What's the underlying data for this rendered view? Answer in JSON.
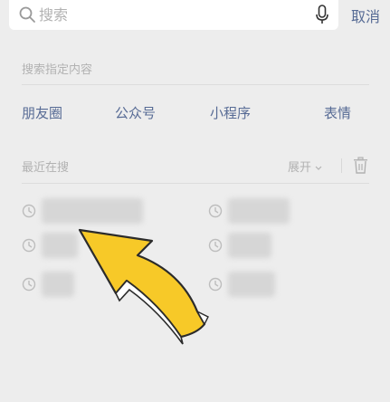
{
  "search": {
    "placeholder": "搜索",
    "cancel_label": "取消"
  },
  "specified": {
    "title": "搜索指定内容",
    "categories": [
      "朋友圈",
      "公众号",
      "小程序",
      "表情"
    ]
  },
  "recent": {
    "title": "最近在搜",
    "expand_label": "展开"
  },
  "icons": {
    "search": "search-icon",
    "mic": "microphone-icon",
    "chevron": "chevron-down-icon",
    "trash": "trash-icon",
    "clock": "clock-icon"
  },
  "colors": {
    "link": "#576B95",
    "muted": "#B2B2B2",
    "arrow": "#F7C928"
  }
}
